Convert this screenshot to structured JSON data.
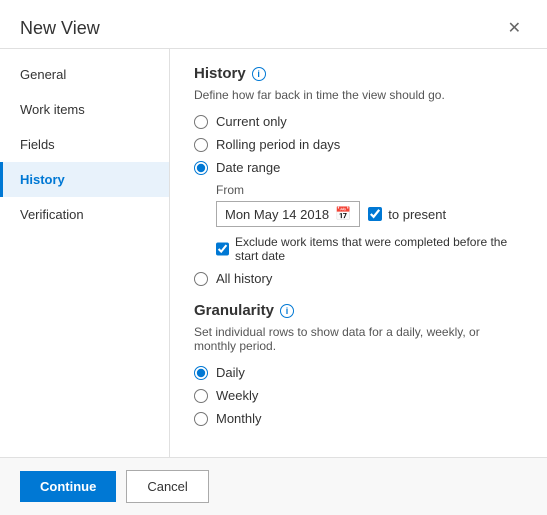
{
  "dialog": {
    "title": "New View",
    "close_label": "✕"
  },
  "sidebar": {
    "items": [
      {
        "id": "general",
        "label": "General",
        "active": false
      },
      {
        "id": "work-items",
        "label": "Work items",
        "active": false
      },
      {
        "id": "fields",
        "label": "Fields",
        "active": false
      },
      {
        "id": "history",
        "label": "History",
        "active": true
      },
      {
        "id": "verification",
        "label": "Verification",
        "active": false
      }
    ]
  },
  "main": {
    "history_section": {
      "title": "History",
      "description": "Define how far back in time the view should go.",
      "options": [
        {
          "id": "current-only",
          "label": "Current only",
          "checked": false
        },
        {
          "id": "rolling-period",
          "label": "Rolling period in days",
          "checked": false
        },
        {
          "id": "date-range",
          "label": "Date range",
          "checked": true
        },
        {
          "id": "all-history",
          "label": "All history",
          "checked": false
        }
      ],
      "date_range": {
        "from_label": "From",
        "date_value": "Mon May 14 2018",
        "to_present_label": "to present",
        "to_present_checked": true,
        "exclude_label": "Exclude work items that were completed before the start date",
        "exclude_checked": true
      }
    },
    "granularity_section": {
      "title": "Granularity",
      "description": "Set individual rows to show data for a daily, weekly, or monthly period.",
      "options": [
        {
          "id": "daily",
          "label": "Daily",
          "checked": true
        },
        {
          "id": "weekly",
          "label": "Weekly",
          "checked": false
        },
        {
          "id": "monthly",
          "label": "Monthly",
          "checked": false
        }
      ]
    }
  },
  "footer": {
    "continue_label": "Continue",
    "cancel_label": "Cancel"
  }
}
